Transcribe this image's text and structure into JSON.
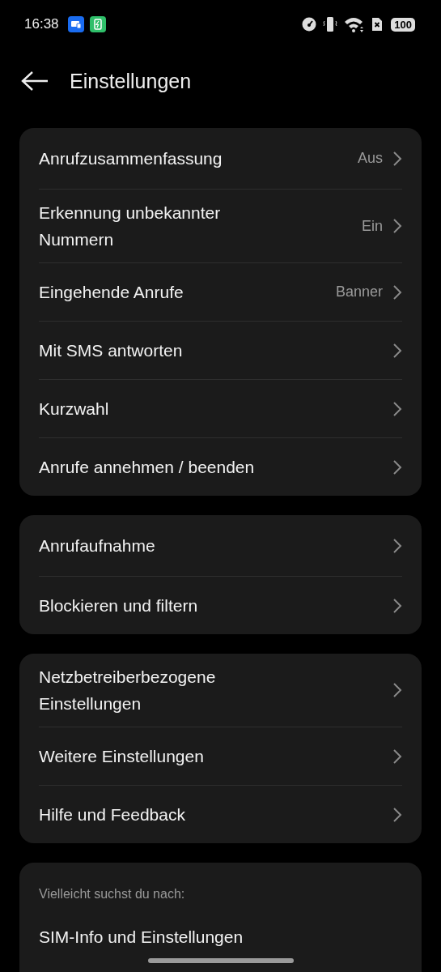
{
  "status_bar": {
    "time": "16:38",
    "battery": "100"
  },
  "header": {
    "title": "Einstellungen"
  },
  "groups": [
    {
      "items": [
        {
          "label": "Anrufzusammenfassung",
          "value": "Aus"
        },
        {
          "label": "Erkennung unbekannter Nummern",
          "value": "Ein"
        },
        {
          "label": "Eingehende Anrufe",
          "value": "Banner"
        },
        {
          "label": "Mit SMS antworten"
        },
        {
          "label": "Kurzwahl"
        },
        {
          "label": "Anrufe annehmen / beenden"
        }
      ]
    },
    {
      "items": [
        {
          "label": "Anrufaufnahme"
        },
        {
          "label": "Blockieren und filtern"
        }
      ]
    },
    {
      "items": [
        {
          "label": "Netzbetreiberbezogene Einstellungen"
        },
        {
          "label": "Weitere Einstellungen"
        },
        {
          "label": "Hilfe und Feedback"
        }
      ]
    }
  ],
  "suggestions": {
    "heading": "Vielleicht suchst du nach:",
    "items": [
      "SIM-Info und Einstellungen"
    ]
  }
}
